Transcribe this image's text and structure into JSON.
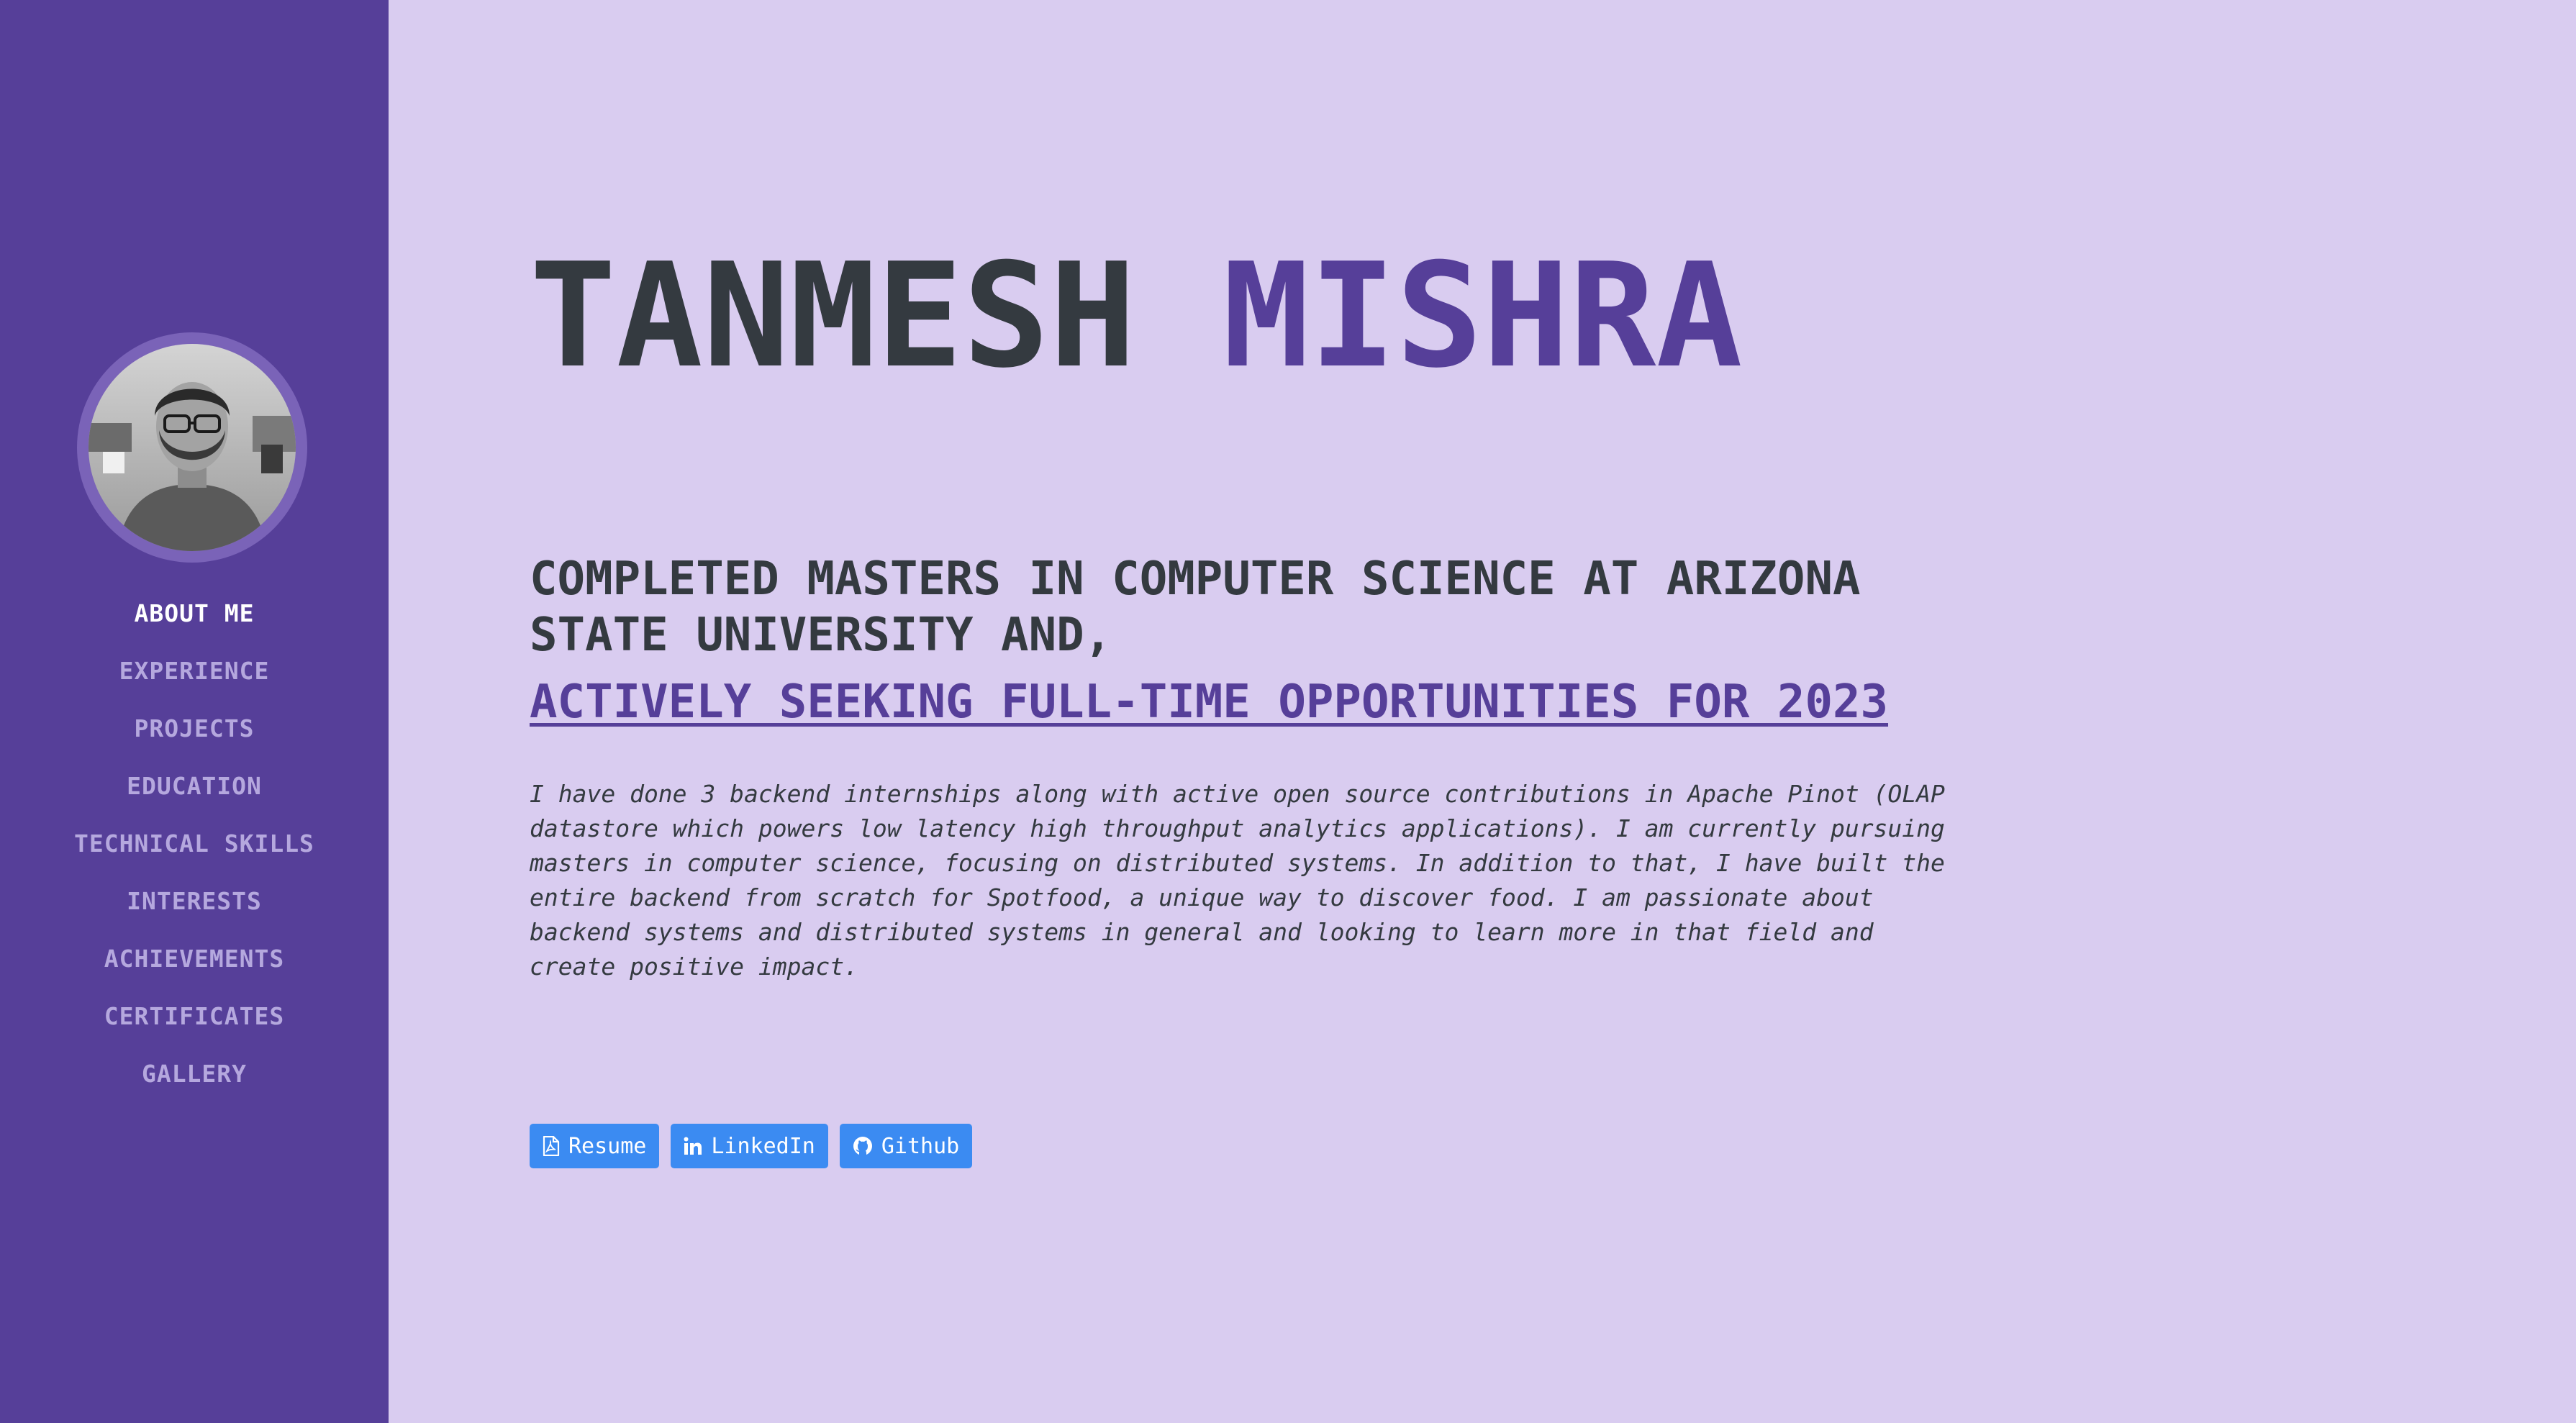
{
  "sidebar": {
    "avatar_alt": "Profile photo",
    "nav": [
      {
        "label": "ABOUT ME",
        "active": true
      },
      {
        "label": "EXPERIENCE"
      },
      {
        "label": "PROJECTS"
      },
      {
        "label": "EDUCATION"
      },
      {
        "label": "TECHNICAL SKILLS"
      },
      {
        "label": "INTERESTS"
      },
      {
        "label": "ACHIEVEMENTS"
      },
      {
        "label": "CERTIFICATES"
      },
      {
        "label": "GALLERY"
      }
    ]
  },
  "main": {
    "first_name": "TANMESH",
    "last_name": "MISHRA",
    "subheading": "COMPLETED MASTERS IN COMPUTER SCIENCE AT ARIZONA STATE UNIVERSITY AND,",
    "seeking": "ACTIVELY SEEKING FULL-TIME OPPORTUNITIES FOR 2023",
    "about": "I have done 3 backend internships along with active open source contributions in Apache Pinot (OLAP datastore which powers low latency high throughput analytics applications). I am currently pursuing masters in computer science, focusing on distributed systems. In addition to that, I have built the entire backend from scratch for Spotfood, a unique way to discover food. I am passionate about backend systems and distributed systems in general and looking to learn more in that field and create positive impact.",
    "buttons": [
      {
        "label": "Resume",
        "icon": "file-pdf-icon"
      },
      {
        "label": "LinkedIn",
        "icon": "linkedin-icon"
      },
      {
        "label": "Github",
        "icon": "github-icon"
      }
    ]
  },
  "colors": {
    "sidebar_bg": "#563f99",
    "page_bg": "#d9ccf0",
    "accent": "#563f99",
    "text": "#343a40",
    "button": "#3b8bf2"
  }
}
